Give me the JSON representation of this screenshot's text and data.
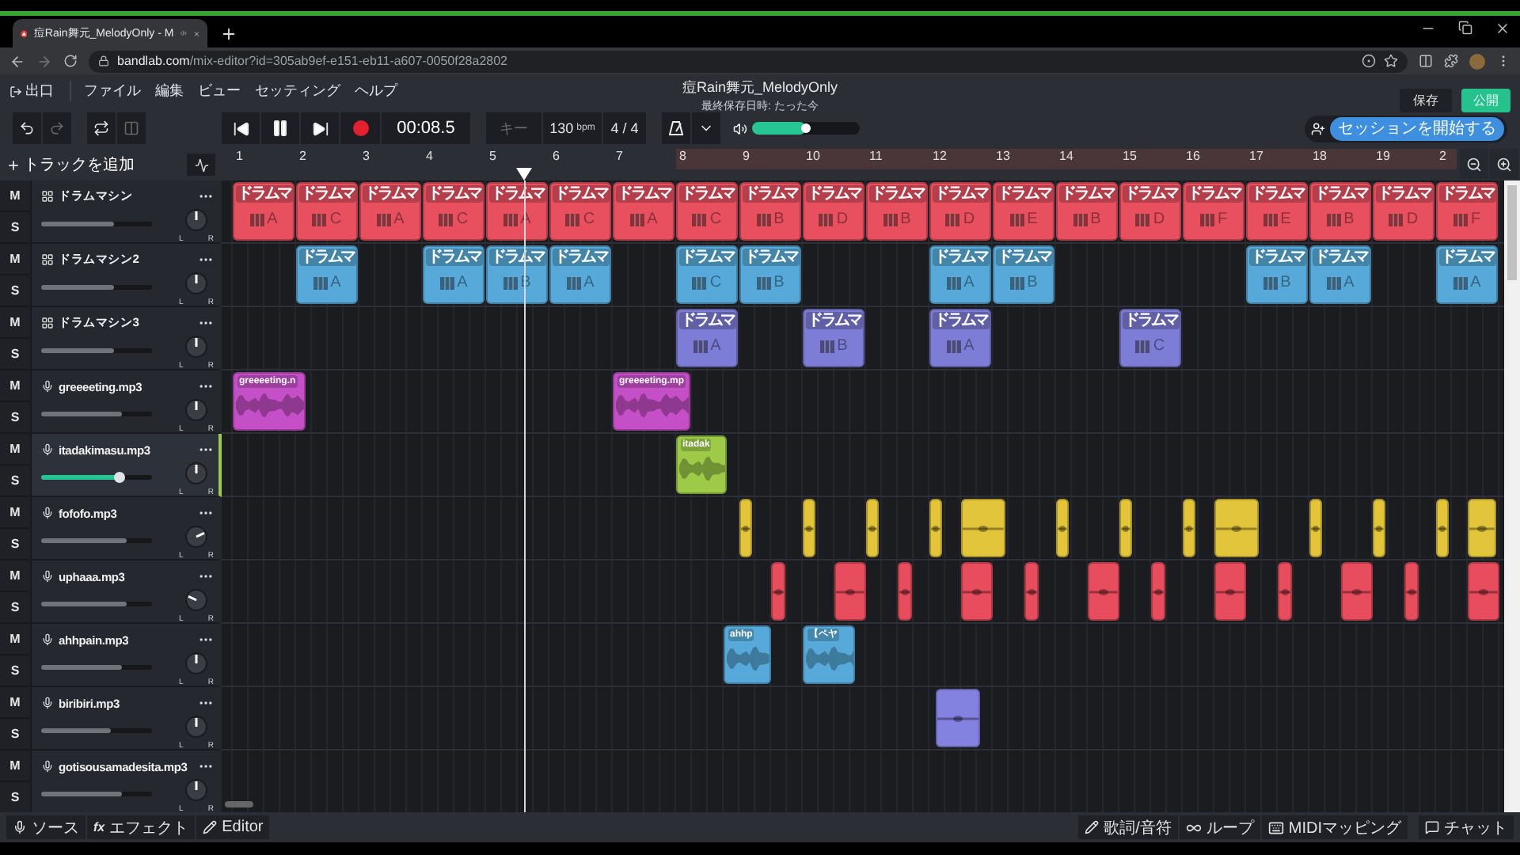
{
  "browser": {
    "tab_title": "痘Rain舞元_MelodyOnly - M",
    "url_host": "bandlab.com",
    "url_path": "/mix-editor?id=305ab9ef-e151-eb11-a607-0050f28a2802"
  },
  "menu": {
    "exit": "出口",
    "items": [
      "ファイル",
      "編集",
      "ビュー",
      "セッティング",
      "ヘルプ"
    ]
  },
  "project": {
    "title": "痘Rain舞元_MelodyOnly",
    "saved": "最終保存日時: たった今"
  },
  "actions": {
    "save": "保存",
    "publish": "公開"
  },
  "transport": {
    "playing": true,
    "time": "00:08.5",
    "key": "キー",
    "tempo": "130",
    "tempo_unit": "bpm",
    "signature": "4 / 4"
  },
  "master_volume": {
    "level": 0.5
  },
  "session_button": "セッションを開始する",
  "add_track": "トラックを追加",
  "ruler": {
    "bars": [
      {
        "label": "1",
        "in_loop": false
      },
      {
        "label": "2",
        "in_loop": false
      },
      {
        "label": "3",
        "in_loop": false
      },
      {
        "label": "4",
        "in_loop": false
      },
      {
        "label": "5",
        "in_loop": false
      },
      {
        "label": "6",
        "in_loop": false
      },
      {
        "label": "7",
        "in_loop": false
      },
      {
        "label": "8",
        "in_loop": true
      },
      {
        "label": "9",
        "in_loop": true
      },
      {
        "label": "10",
        "in_loop": true
      },
      {
        "label": "11",
        "in_loop": true
      },
      {
        "label": "12",
        "in_loop": true
      },
      {
        "label": "13",
        "in_loop": true
      },
      {
        "label": "14",
        "in_loop": true
      },
      {
        "label": "15",
        "in_loop": true
      },
      {
        "label": "16",
        "in_loop": true
      },
      {
        "label": "17",
        "in_loop": true
      },
      {
        "label": "18",
        "in_loop": true
      },
      {
        "label": "19",
        "in_loop": true
      },
      {
        "label": "2",
        "in_loop": true
      }
    ]
  },
  "tracks": [
    {
      "name": "ドラムマシン",
      "kind": "drum",
      "color": "#e8505f",
      "selected": false,
      "mute": "M",
      "solo": "S",
      "pan_left": "L",
      "pan_right": "R",
      "volume": {
        "level": 0.65
      },
      "clips": [
        {
          "kind": "drum",
          "label": "ドラムマ",
          "pattern": "A"
        },
        {
          "kind": "drum",
          "label": "ドラムマ",
          "pattern": "C"
        },
        {
          "kind": "drum",
          "label": "ドラムマ",
          "pattern": "A"
        },
        {
          "kind": "drum",
          "label": "ドラムマ",
          "pattern": "C"
        },
        {
          "kind": "drum",
          "label": "ドラムマ",
          "pattern": "A"
        },
        {
          "kind": "drum",
          "label": "ドラムマ",
          "pattern": "C"
        },
        {
          "kind": "drum",
          "label": "ドラムマ",
          "pattern": "A"
        },
        {
          "kind": "drum",
          "label": "ドラムマ",
          "pattern": "C"
        },
        {
          "kind": "drum",
          "label": "ドラムマ",
          "pattern": "B"
        },
        {
          "kind": "drum",
          "label": "ドラムマ",
          "pattern": "D"
        },
        {
          "kind": "drum",
          "label": "ドラムマ",
          "pattern": "B"
        },
        {
          "kind": "drum",
          "label": "ドラムマ",
          "pattern": "D"
        },
        {
          "kind": "drum",
          "label": "ドラムマ",
          "pattern": "E"
        },
        {
          "kind": "drum",
          "label": "ドラムマ",
          "pattern": "B"
        },
        {
          "kind": "drum",
          "label": "ドラムマ",
          "pattern": "D"
        },
        {
          "kind": "drum",
          "label": "ドラムマ",
          "pattern": "F"
        },
        {
          "kind": "drum",
          "label": "ドラムマ",
          "pattern": "E"
        },
        {
          "kind": "drum",
          "label": "ドラムマ",
          "pattern": "B"
        },
        {
          "kind": "drum",
          "label": "ドラムマ",
          "pattern": "D"
        },
        {
          "kind": "drum",
          "label": "ドラムマ",
          "pattern": "F"
        }
      ]
    },
    {
      "name": "ドラムマシン2",
      "kind": "drum",
      "color": "#56a9d9",
      "selected": false,
      "mute": "M",
      "solo": "S",
      "pan_left": "L",
      "pan_right": "R",
      "volume": {
        "level": 0.65
      },
      "clips": [
        {
          "kind": "drum",
          "label": "ドラムマ",
          "pattern": "A"
        },
        {
          "kind": "drum",
          "label": "ドラムマ",
          "pattern": "A"
        },
        {
          "kind": "drum",
          "label": "ドラムマ",
          "pattern": "B"
        },
        {
          "kind": "drum",
          "label": "ドラムマ",
          "pattern": "A"
        },
        {
          "kind": "drum",
          "label": "ドラムマ",
          "pattern": "C"
        },
        {
          "kind": "drum",
          "label": "ドラムマ",
          "pattern": "B"
        },
        {
          "kind": "drum",
          "label": "ドラムマ",
          "pattern": "A"
        },
        {
          "kind": "drum",
          "label": "ドラムマ",
          "pattern": "B"
        },
        {
          "kind": "drum",
          "label": "ドラムマ",
          "pattern": "B"
        },
        {
          "kind": "drum",
          "label": "ドラムマ",
          "pattern": "A"
        },
        {
          "kind": "drum",
          "label": "ドラムマ",
          "pattern": "A"
        }
      ]
    },
    {
      "name": "ドラムマシン3",
      "kind": "drum",
      "color": "#7d7cd6",
      "selected": false,
      "mute": "M",
      "solo": "S",
      "pan_left": "L",
      "pan_right": "R",
      "volume": {
        "level": 0.65
      },
      "clips": [
        {
          "kind": "drum",
          "label": "ドラムマ",
          "pattern": "A"
        },
        {
          "kind": "drum",
          "label": "ドラムマ",
          "pattern": "B"
        },
        {
          "kind": "drum",
          "label": "ドラムマ",
          "pattern": "A"
        },
        {
          "kind": "drum",
          "label": "ドラムマ",
          "pattern": "C"
        }
      ]
    },
    {
      "name": "greeeeting.mp3",
      "kind": "audio",
      "color": "#c54fc7",
      "selected": false,
      "mute": "M",
      "solo": "S",
      "pan_left": "L",
      "pan_right": "R",
      "volume": {
        "level": 0.73
      },
      "clips": [
        {
          "kind": "audio",
          "label": "greeeeting.n"
        },
        {
          "kind": "audio",
          "label": "greeeeting.mp"
        }
      ]
    },
    {
      "name": "itadakimasu.mp3",
      "kind": "audio",
      "color": "#9dcb48",
      "selected": true,
      "mute": "M",
      "solo": "S",
      "pan_left": "L",
      "pan_right": "R",
      "volume": {
        "level": 0.7
      },
      "clips": [
        {
          "kind": "audio",
          "label": "itadak"
        }
      ]
    },
    {
      "name": "fofofo.mp3",
      "kind": "audio",
      "color": "#e2c53b",
      "selected": false,
      "mute": "M",
      "solo": "S",
      "pan_left": "L",
      "pan_right": "R",
      "volume": {
        "level": 0.77
      },
      "clips": [
        {
          "kind": "hit"
        },
        {
          "kind": "hit"
        },
        {
          "kind": "hit"
        },
        {
          "kind": "hit"
        },
        {
          "kind": "hit"
        },
        {
          "kind": "hit"
        },
        {
          "kind": "hit"
        },
        {
          "kind": "hit"
        },
        {
          "kind": "hit"
        },
        {
          "kind": "hit"
        },
        {
          "kind": "hit"
        },
        {
          "kind": "hit"
        },
        {
          "kind": "hit"
        }
      ]
    },
    {
      "name": "uphaaa.mp3",
      "kind": "audio",
      "color": "#e84d5d",
      "selected": false,
      "mute": "M",
      "solo": "S",
      "pan_left": "L",
      "pan_right": "R",
      "volume": {
        "level": 0.77
      },
      "clips": [
        {
          "kind": "hit"
        },
        {
          "kind": "hit"
        },
        {
          "kind": "hit"
        },
        {
          "kind": "hit"
        },
        {
          "kind": "hit"
        },
        {
          "kind": "hit"
        },
        {
          "kind": "hit"
        },
        {
          "kind": "hit"
        },
        {
          "kind": "hit"
        },
        {
          "kind": "hit"
        },
        {
          "kind": "hit"
        },
        {
          "kind": "hit"
        }
      ]
    },
    {
      "name": "ahhpain.mp3",
      "kind": "audio",
      "color": "#56a9d9",
      "selected": false,
      "mute": "M",
      "solo": "S",
      "pan_left": "L",
      "pan_right": "R",
      "volume": {
        "level": 0.73
      },
      "clips": [
        {
          "kind": "audio",
          "label": "ahhp"
        },
        {
          "kind": "audio",
          "label": "【ペヤ"
        }
      ]
    },
    {
      "name": "biribiri.mp3",
      "kind": "audio",
      "color": "#8482e0",
      "selected": false,
      "mute": "M",
      "solo": "S",
      "pan_left": "L",
      "pan_right": "R",
      "volume": {
        "level": 0.63
      },
      "clips": [
        {
          "kind": "hit"
        }
      ]
    },
    {
      "name": "gotisousamadesita.mp3",
      "kind": "audio",
      "selected": false,
      "mute": "M",
      "solo": "S",
      "pan_left": "L",
      "pan_right": "R",
      "volume": {
        "level": 0.73
      }
    }
  ],
  "bottom_left": [
    "ソース",
    "エフェクト",
    "Editor"
  ],
  "bottom_left_fx": "fx",
  "bottom_right": [
    "歌詞/音符",
    "ループ",
    "MIDIマッピング",
    "チャット"
  ]
}
